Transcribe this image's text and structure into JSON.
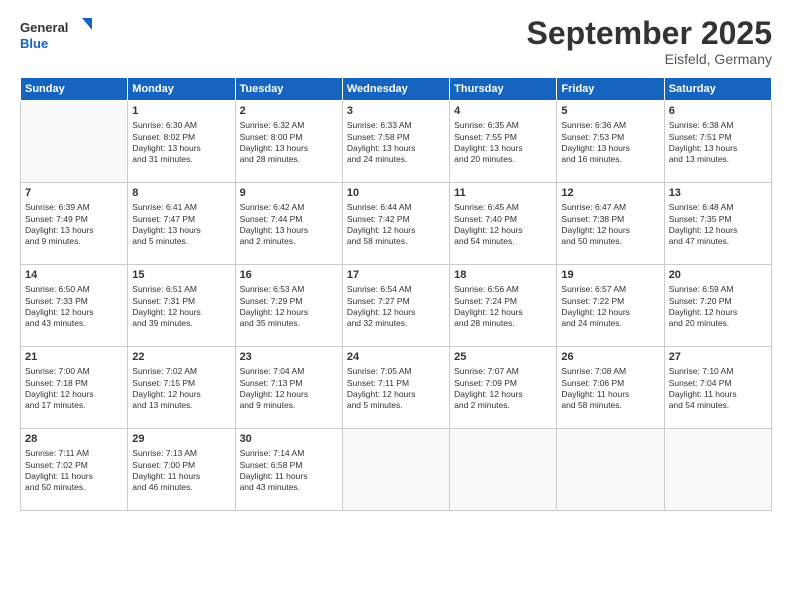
{
  "logo": {
    "general": "General",
    "blue": "Blue"
  },
  "header": {
    "month": "September 2025",
    "location": "Eisfeld, Germany"
  },
  "days_of_week": [
    "Sunday",
    "Monday",
    "Tuesday",
    "Wednesday",
    "Thursday",
    "Friday",
    "Saturday"
  ],
  "weeks": [
    [
      {
        "day": "",
        "info": ""
      },
      {
        "day": "1",
        "info": "Sunrise: 6:30 AM\nSunset: 8:02 PM\nDaylight: 13 hours\nand 31 minutes."
      },
      {
        "day": "2",
        "info": "Sunrise: 6:32 AM\nSunset: 8:00 PM\nDaylight: 13 hours\nand 28 minutes."
      },
      {
        "day": "3",
        "info": "Sunrise: 6:33 AM\nSunset: 7:58 PM\nDaylight: 13 hours\nand 24 minutes."
      },
      {
        "day": "4",
        "info": "Sunrise: 6:35 AM\nSunset: 7:55 PM\nDaylight: 13 hours\nand 20 minutes."
      },
      {
        "day": "5",
        "info": "Sunrise: 6:36 AM\nSunset: 7:53 PM\nDaylight: 13 hours\nand 16 minutes."
      },
      {
        "day": "6",
        "info": "Sunrise: 6:38 AM\nSunset: 7:51 PM\nDaylight: 13 hours\nand 13 minutes."
      }
    ],
    [
      {
        "day": "7",
        "info": "Sunrise: 6:39 AM\nSunset: 7:49 PM\nDaylight: 13 hours\nand 9 minutes."
      },
      {
        "day": "8",
        "info": "Sunrise: 6:41 AM\nSunset: 7:47 PM\nDaylight: 13 hours\nand 5 minutes."
      },
      {
        "day": "9",
        "info": "Sunrise: 6:42 AM\nSunset: 7:44 PM\nDaylight: 13 hours\nand 2 minutes."
      },
      {
        "day": "10",
        "info": "Sunrise: 6:44 AM\nSunset: 7:42 PM\nDaylight: 12 hours\nand 58 minutes."
      },
      {
        "day": "11",
        "info": "Sunrise: 6:45 AM\nSunset: 7:40 PM\nDaylight: 12 hours\nand 54 minutes."
      },
      {
        "day": "12",
        "info": "Sunrise: 6:47 AM\nSunset: 7:38 PM\nDaylight: 12 hours\nand 50 minutes."
      },
      {
        "day": "13",
        "info": "Sunrise: 6:48 AM\nSunset: 7:35 PM\nDaylight: 12 hours\nand 47 minutes."
      }
    ],
    [
      {
        "day": "14",
        "info": "Sunrise: 6:50 AM\nSunset: 7:33 PM\nDaylight: 12 hours\nand 43 minutes."
      },
      {
        "day": "15",
        "info": "Sunrise: 6:51 AM\nSunset: 7:31 PM\nDaylight: 12 hours\nand 39 minutes."
      },
      {
        "day": "16",
        "info": "Sunrise: 6:53 AM\nSunset: 7:29 PM\nDaylight: 12 hours\nand 35 minutes."
      },
      {
        "day": "17",
        "info": "Sunrise: 6:54 AM\nSunset: 7:27 PM\nDaylight: 12 hours\nand 32 minutes."
      },
      {
        "day": "18",
        "info": "Sunrise: 6:56 AM\nSunset: 7:24 PM\nDaylight: 12 hours\nand 28 minutes."
      },
      {
        "day": "19",
        "info": "Sunrise: 6:57 AM\nSunset: 7:22 PM\nDaylight: 12 hours\nand 24 minutes."
      },
      {
        "day": "20",
        "info": "Sunrise: 6:59 AM\nSunset: 7:20 PM\nDaylight: 12 hours\nand 20 minutes."
      }
    ],
    [
      {
        "day": "21",
        "info": "Sunrise: 7:00 AM\nSunset: 7:18 PM\nDaylight: 12 hours\nand 17 minutes."
      },
      {
        "day": "22",
        "info": "Sunrise: 7:02 AM\nSunset: 7:15 PM\nDaylight: 12 hours\nand 13 minutes."
      },
      {
        "day": "23",
        "info": "Sunrise: 7:04 AM\nSunset: 7:13 PM\nDaylight: 12 hours\nand 9 minutes."
      },
      {
        "day": "24",
        "info": "Sunrise: 7:05 AM\nSunset: 7:11 PM\nDaylight: 12 hours\nand 5 minutes."
      },
      {
        "day": "25",
        "info": "Sunrise: 7:07 AM\nSunset: 7:09 PM\nDaylight: 12 hours\nand 2 minutes."
      },
      {
        "day": "26",
        "info": "Sunrise: 7:08 AM\nSunset: 7:06 PM\nDaylight: 11 hours\nand 58 minutes."
      },
      {
        "day": "27",
        "info": "Sunrise: 7:10 AM\nSunset: 7:04 PM\nDaylight: 11 hours\nand 54 minutes."
      }
    ],
    [
      {
        "day": "28",
        "info": "Sunrise: 7:11 AM\nSunset: 7:02 PM\nDaylight: 11 hours\nand 50 minutes."
      },
      {
        "day": "29",
        "info": "Sunrise: 7:13 AM\nSunset: 7:00 PM\nDaylight: 11 hours\nand 46 minutes."
      },
      {
        "day": "30",
        "info": "Sunrise: 7:14 AM\nSunset: 6:58 PM\nDaylight: 11 hours\nand 43 minutes."
      },
      {
        "day": "",
        "info": ""
      },
      {
        "day": "",
        "info": ""
      },
      {
        "day": "",
        "info": ""
      },
      {
        "day": "",
        "info": ""
      }
    ]
  ]
}
